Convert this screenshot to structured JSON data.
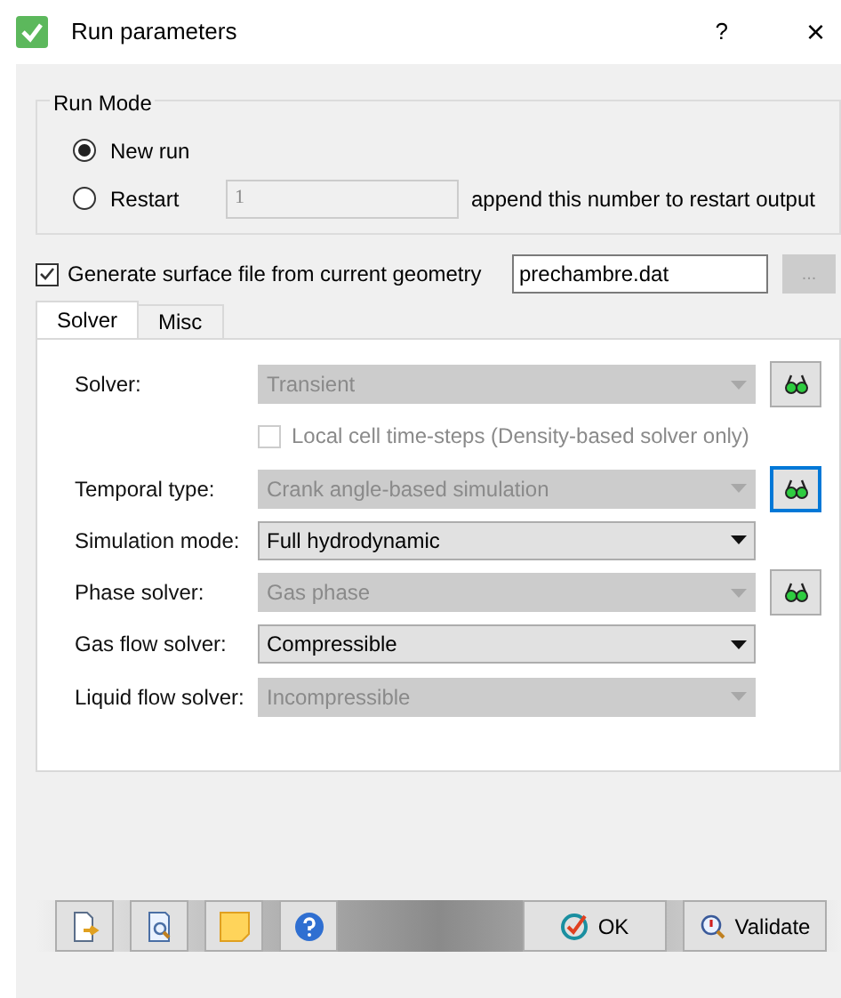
{
  "window": {
    "title": "Run parameters",
    "help": "?",
    "close": "×"
  },
  "run_mode": {
    "title": "Run Mode",
    "options": [
      {
        "label": "New run",
        "selected": true
      },
      {
        "label": "Restart",
        "selected": false
      }
    ],
    "restart_number": {
      "value": "1",
      "disabled": true
    },
    "restart_hint": "append this number to restart output"
  },
  "surface_file": {
    "label": "Generate surface file from current geometry",
    "checked": true,
    "value": "prechambre.dat",
    "browse": {
      "label": "...",
      "disabled": true
    }
  },
  "tabs": [
    {
      "label": "Solver",
      "selected": true
    },
    {
      "label": "Misc",
      "selected": false
    }
  ],
  "rows": [
    {
      "kind": "combo",
      "label": "Solver:",
      "value": "Transient",
      "disabled": true,
      "view_button": {
        "focused": false
      }
    },
    {
      "kind": "checkbox",
      "label": "Local cell time-steps (Density-based solver only)",
      "checked": false,
      "disabled": true
    },
    {
      "kind": "combo",
      "label": "Temporal type:",
      "value": "Crank angle-based simulation",
      "disabled": true,
      "view_button": {
        "focused": true
      }
    },
    {
      "kind": "combo",
      "label": "Simulation mode:",
      "value": "Full hydrodynamic",
      "disabled": false
    },
    {
      "kind": "combo",
      "label": "Phase solver:",
      "value": "Gas phase",
      "disabled": true,
      "view_button": {
        "focused": false
      }
    },
    {
      "kind": "combo",
      "label": "Gas flow solver:",
      "value": "Compressible",
      "disabled": false
    },
    {
      "kind": "combo",
      "label": "Liquid flow solver:",
      "value": "Incompressible",
      "disabled": true
    }
  ],
  "buttons": [
    {
      "label": "OK"
    },
    {
      "label": "Validate"
    }
  ]
}
